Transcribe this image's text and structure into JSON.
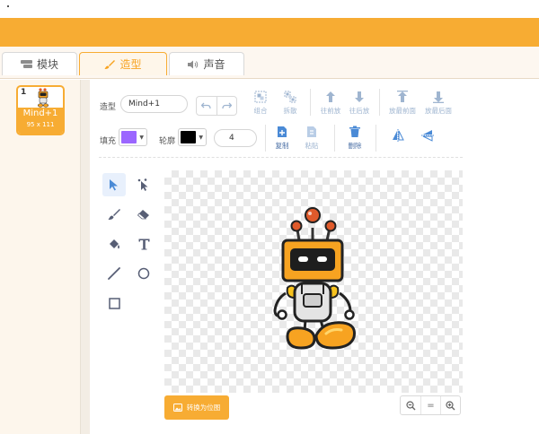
{
  "tabs": [
    {
      "label": "模块",
      "icon": "code-blocks-icon",
      "active": false
    },
    {
      "label": "造型",
      "icon": "paintbrush-icon",
      "active": true
    },
    {
      "label": "声音",
      "icon": "speaker-icon",
      "active": false
    }
  ],
  "sprite": {
    "number": "1",
    "name": "Mind+1",
    "size": "95 x 111"
  },
  "costume": {
    "label": "造型",
    "name_value": "Mind+1"
  },
  "toolbar": {
    "group": "组合",
    "ungroup": "拆散",
    "forward": "往前放",
    "backward": "往后放",
    "front": "放最前面",
    "back": "放最后面",
    "copy": "复制",
    "paste": "粘贴",
    "delete": "删除"
  },
  "fill": {
    "label": "填充",
    "color": "#9b66ff"
  },
  "outline": {
    "label": "轮廓",
    "color": "#000000",
    "width": "4"
  },
  "convert_button": "转换为位图",
  "zoom": {
    "out": "zoom-out-icon",
    "reset": "=",
    "in": "zoom-in-icon"
  },
  "colors": {
    "accent": "#f7ac33",
    "tab_active_text": "#f7a321",
    "tool_blue": "#4a6fa5"
  }
}
